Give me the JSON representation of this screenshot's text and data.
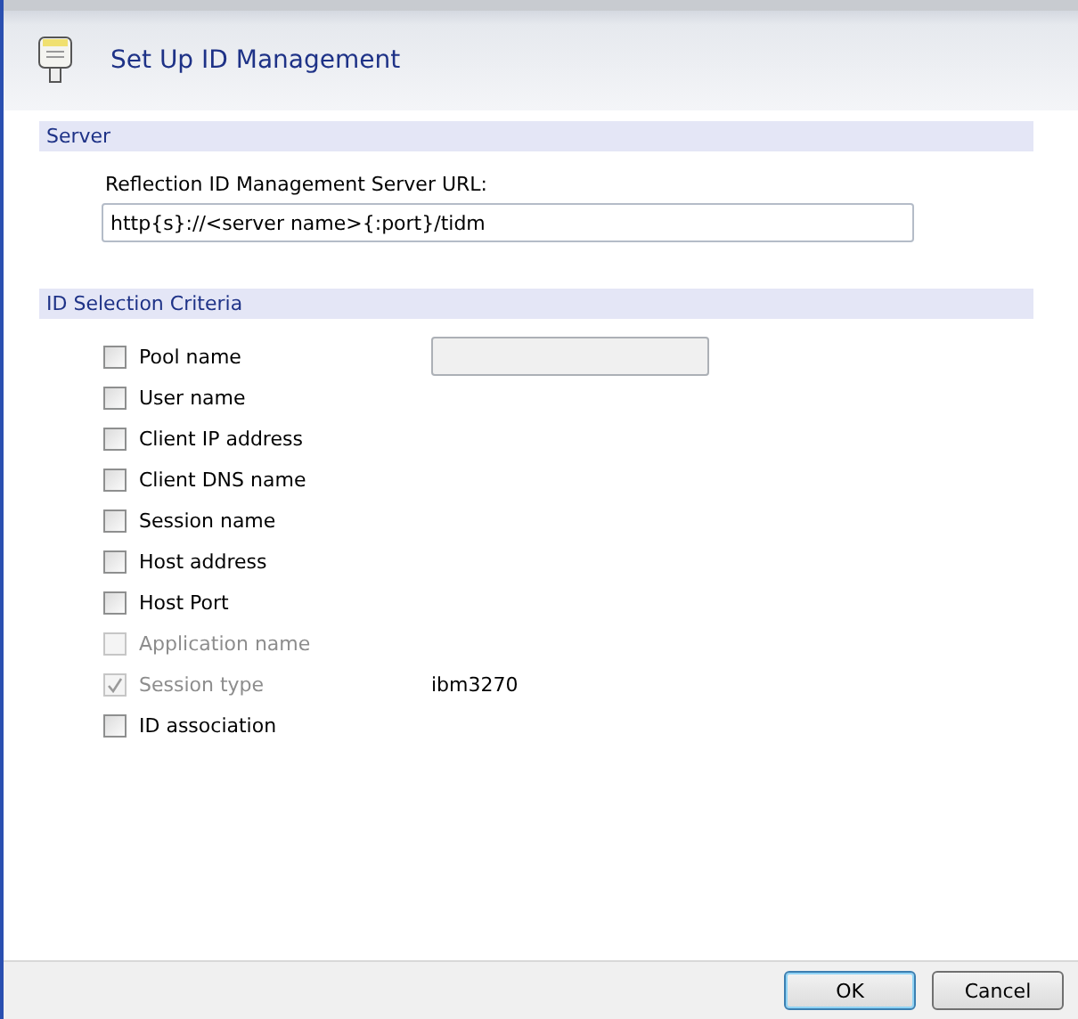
{
  "window": {
    "title": "Set Up ID Management"
  },
  "server": {
    "heading": "Server",
    "label": "Reflection ID Management Server URL:",
    "value": "http{s}://<server name>{:port}/tidm"
  },
  "criteria": {
    "heading": "ID Selection Criteria",
    "items": [
      {
        "kind": "with-field",
        "label": "Pool name",
        "checked": false,
        "disabled": false,
        "field_disabled": true
      },
      {
        "kind": "plain",
        "label": "User name",
        "checked": false,
        "disabled": false
      },
      {
        "kind": "plain",
        "label": "Client IP address",
        "checked": false,
        "disabled": false
      },
      {
        "kind": "plain",
        "label": "Client DNS name",
        "checked": false,
        "disabled": false
      },
      {
        "kind": "plain",
        "label": "Session name",
        "checked": false,
        "disabled": false
      },
      {
        "kind": "plain",
        "label": "Host address",
        "checked": false,
        "disabled": false
      },
      {
        "kind": "plain",
        "label": "Host Port",
        "checked": false,
        "disabled": false
      },
      {
        "kind": "plain",
        "label": "Application name",
        "checked": false,
        "disabled": true
      },
      {
        "kind": "with-value",
        "label": "Session type",
        "checked": true,
        "disabled": true,
        "value": "ibm3270"
      },
      {
        "kind": "plain",
        "label": "ID association",
        "checked": false,
        "disabled": false
      }
    ]
  },
  "buttons": [
    {
      "label": "OK",
      "default": true
    },
    {
      "label": "Cancel",
      "default": false
    }
  ]
}
